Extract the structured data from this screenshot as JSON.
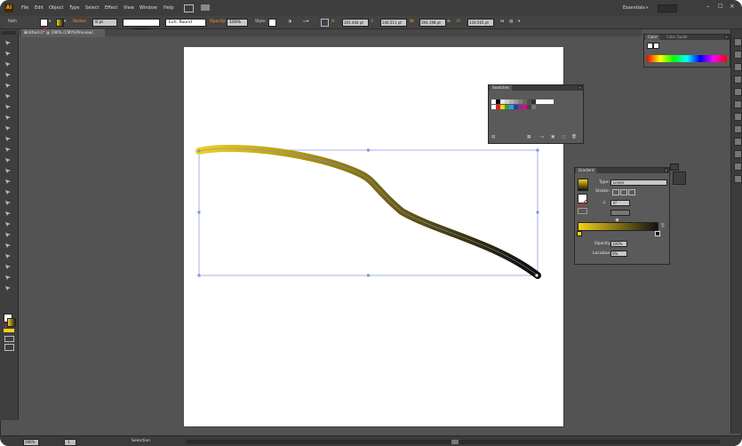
{
  "app": {
    "logo": "Ai",
    "workspace": "Essentials"
  },
  "menu": [
    "File",
    "Edit",
    "Object",
    "Type",
    "Select",
    "Effect",
    "View",
    "Window",
    "Help"
  ],
  "control_bar": {
    "selection_label": "Path",
    "stroke_label": "Stroke:",
    "stroke_weight": "8 pt",
    "profile_label": "Exh. Round",
    "opacity_label": "Opacity:",
    "opacity_value": "100%",
    "style_label": "Style:",
    "x_label": "X:",
    "x_value": "305.404 pt",
    "y_label": "Y:",
    "y_value": "246.511 pt",
    "w_label": "W:",
    "w_value": "394.198 pt",
    "h_label": "H:",
    "h_value": "139.565 pt"
  },
  "document_tab": {
    "title": "Untitled-1* @ 196% (CMYK/Preview)",
    "close": "×"
  },
  "panels": {
    "color": {
      "tabs": [
        "Color",
        "Color Guide"
      ]
    },
    "swatches": {
      "tab": "Swatches"
    },
    "gradient": {
      "tab": "Gradient",
      "type_label": "Type:",
      "type_value": "Linear",
      "stroke_label": "Stroke:",
      "angle_value": "0°",
      "opacity_label": "Opacity:",
      "opacity_value": "100%",
      "location_label": "Location:",
      "location_value": "0%"
    }
  },
  "status_bar": {
    "zoom": "196%",
    "page": "1",
    "tool": "Selection"
  },
  "icons": [
    "selection-icon",
    "direct-selection-icon",
    "pen-icon",
    "type-icon",
    "line-icon",
    "rectangle-icon",
    "brush-icon",
    "pencil-icon",
    "eraser-icon",
    "rotate-icon",
    "scale-icon",
    "warp-icon",
    "free-transform-icon",
    "shape-builder-icon",
    "mesh-icon",
    "gradient-tool-icon",
    "eyedropper-icon",
    "blend-icon",
    "symbol-sprayer-icon",
    "graph-icon",
    "artboard-icon",
    "slice-icon",
    "hand-icon",
    "zoom-icon"
  ],
  "colors": {
    "gradient_start": "#f2d11b",
    "gradient_end": "#0a0a0a",
    "selection": "#7f8fe8",
    "accent": "#ff9c2a"
  }
}
